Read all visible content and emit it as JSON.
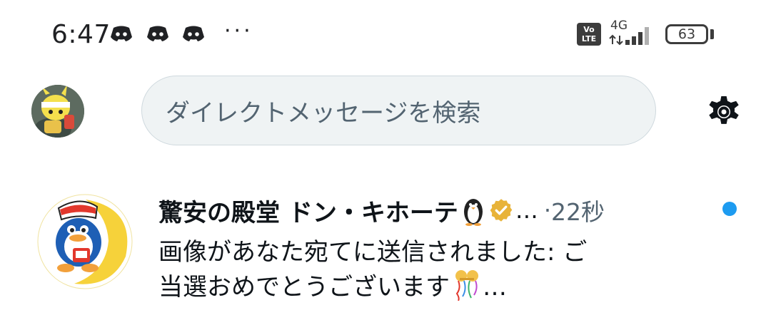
{
  "status_bar": {
    "time": "6:47",
    "notification_icons": [
      "discord-icon",
      "discord-icon",
      "discord-icon"
    ],
    "more": "···",
    "volte": [
      "Vo",
      "LTE"
    ],
    "network": "4G",
    "battery": "63"
  },
  "header": {
    "search_placeholder": "ダイレクトメッセージを検索",
    "settings_icon": "gear-icon"
  },
  "conversation": {
    "name": "驚安の殿堂 ドン・キホーテ",
    "badges": [
      "penguin-emoji",
      "verified-gold-icon"
    ],
    "ellipsis": "…",
    "separator": "·",
    "time": "22秒",
    "unread": true,
    "preview_line1": "画像があなた宛てに送信されました: ご",
    "preview_line2": "当選おめでとうございます",
    "preview_ellipsis": "…"
  },
  "colors": {
    "accent": "#1d9bf0",
    "text": "#0f1419",
    "secondary_text": "#536471",
    "search_bg": "#eff3f4",
    "verified_gold": "#e8b339"
  }
}
